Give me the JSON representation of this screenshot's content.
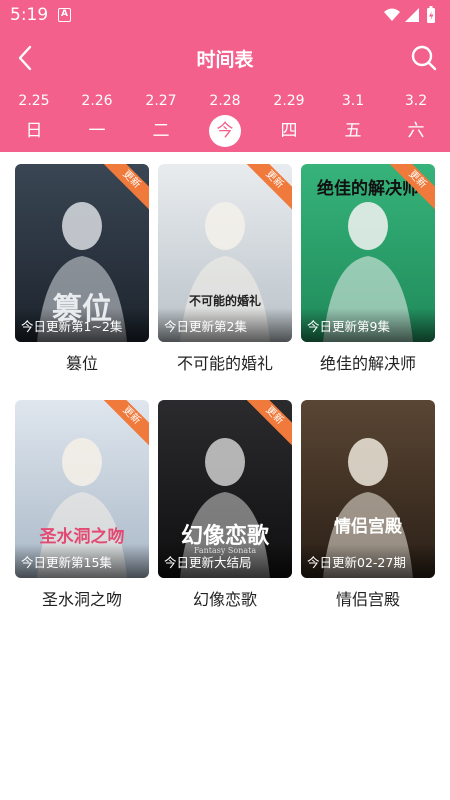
{
  "status": {
    "time": "5:19",
    "notif_letter": "A"
  },
  "header": {
    "title": "时间表"
  },
  "colors": {
    "accent": "#f4608c",
    "badge": "#f07a3c"
  },
  "dates": [
    {
      "date": "2.25",
      "weekday": "日"
    },
    {
      "date": "2.26",
      "weekday": "一"
    },
    {
      "date": "2.27",
      "weekday": "二"
    },
    {
      "date": "2.28",
      "weekday": "今"
    },
    {
      "date": "2.29",
      "weekday": "四"
    },
    {
      "date": "3.1",
      "weekday": "五"
    },
    {
      "date": "3.2",
      "weekday": "六"
    }
  ],
  "active_date_index": 3,
  "shows": [
    {
      "title": "篡位",
      "update": "今日更新第1~2集",
      "badge": "更新",
      "poster_text": "篡位"
    },
    {
      "title": "不可能的婚礼",
      "update": "今日更新第2集",
      "badge": "更新",
      "poster_text": "不可能的婚礼"
    },
    {
      "title": "绝佳的解决师",
      "update": "今日更新第9集",
      "badge": "更新",
      "poster_text": "绝佳的解决师"
    },
    {
      "title": "圣水洞之吻",
      "update": "今日更新第15集",
      "badge": "更新",
      "poster_text": "圣水洞之吻"
    },
    {
      "title": "幻像恋歌",
      "update": "今日更新大结局",
      "badge": "更新",
      "poster_text": "幻像恋歌",
      "poster_subtext": "Fantasy Sonata"
    },
    {
      "title": "情侣宫殿",
      "update": "今日更新02-27期",
      "badge": "",
      "poster_text": "情侣宫殿"
    }
  ]
}
